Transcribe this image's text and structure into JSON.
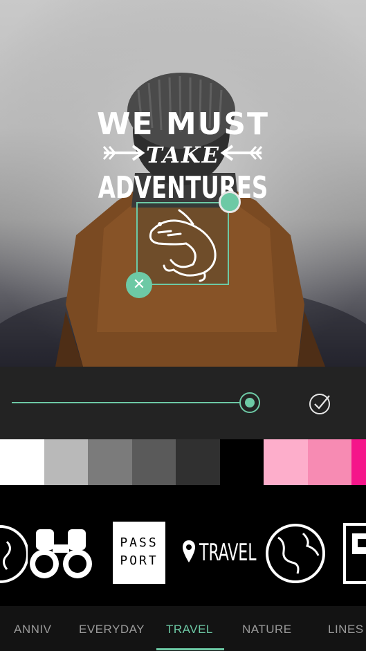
{
  "canvas": {
    "quote_line1": "WE MUST",
    "quote_line2": "TAKE",
    "quote_line3": "ADVENTURES"
  },
  "editor": {
    "delete_symbol": "✕",
    "slider_value": 0.97,
    "confirm_icon": "checkmark-circle-icon"
  },
  "palette": [
    "#ffffff",
    "#b9b9b9",
    "#7b7b7b",
    "#5a5a5a",
    "#303030",
    "#000000",
    "#fdaecb",
    "#f78bb3",
    "#f5168a"
  ],
  "stickers": [
    {
      "icon": "globe-icon"
    },
    {
      "icon": "binoculars-icon"
    },
    {
      "icon": "passport-icon",
      "line1": "PASS",
      "line2": "PORT"
    },
    {
      "icon": "location-travel-icon",
      "label": "TRAVEL"
    },
    {
      "icon": "globe-icon"
    },
    {
      "icon": "photo-frame-icon"
    }
  ],
  "tabs": [
    {
      "label": "ANNIV",
      "active": false
    },
    {
      "label": "EVERYDAY",
      "active": false
    },
    {
      "label": "TRAVEL",
      "active": true
    },
    {
      "label": "NATURE",
      "active": false
    },
    {
      "label": "LINES",
      "active": false
    }
  ],
  "colors": {
    "accent": "#6dc9a5",
    "toolbar": "#232323",
    "tabbar": "#131313"
  }
}
